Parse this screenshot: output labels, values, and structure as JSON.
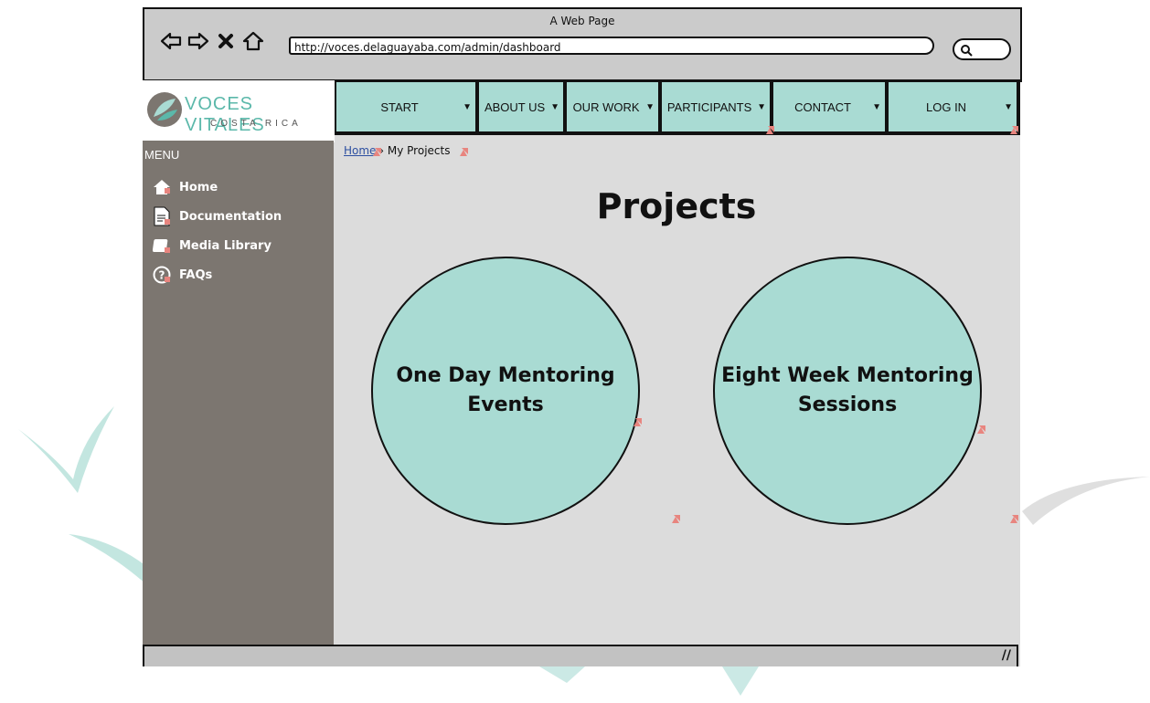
{
  "browser": {
    "title": "A Web Page",
    "url": "http://voces.delaguayaba.com/admin/dashboard",
    "icons": [
      "back-arrow-icon",
      "forward-arrow-icon",
      "close-icon",
      "home-icon",
      "search-icon"
    ]
  },
  "logo": {
    "title": "VOCES VITALES",
    "subtitle": "COSTA RICA"
  },
  "nav": {
    "items": [
      {
        "label": "START"
      },
      {
        "label": "ABOUT US"
      },
      {
        "label": "OUR WORK"
      },
      {
        "label": "PARTICIPANTS"
      },
      {
        "label": "CONTACT"
      },
      {
        "label": "LOG IN"
      }
    ]
  },
  "sidebar": {
    "title": "MENU",
    "items": [
      {
        "label": "Home",
        "icon": "home-icon"
      },
      {
        "label": "Documentation",
        "icon": "document-icon"
      },
      {
        "label": "Media Library",
        "icon": "media-icon"
      },
      {
        "label": "FAQs",
        "icon": "question-icon"
      }
    ]
  },
  "breadcrumb": {
    "home": "Home",
    "current": "My Projects"
  },
  "main": {
    "title": "Projects",
    "projects": [
      {
        "line1": "One Day Mentoring",
        "line2": "Events"
      },
      {
        "line1": "Eight Week Mentoring",
        "line2": "Sessions"
      }
    ]
  },
  "colors": {
    "teal": "#a9dbd3",
    "sidebar": "#7c7670",
    "content": "#dcdcdc",
    "link_marker": "#e8857f"
  }
}
